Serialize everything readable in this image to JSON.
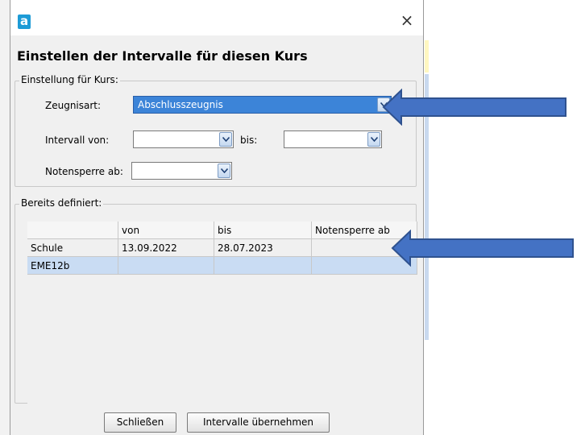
{
  "window": {
    "title": "Einstellen der Intervalle für diesen Kurs",
    "app_logo": "a",
    "close_glyph": "×"
  },
  "settings": {
    "legend": "Einstellung für Kurs:",
    "zeugnisart_label": "Zeugnisart:",
    "zeugnisart_value": "Abschlusszeugnis",
    "intervall_von_label": "Intervall von:",
    "intervall_von_value": "",
    "bis_label": "bis:",
    "bis_value": "",
    "notensperre_label": "Notensperre ab:",
    "notensperre_value": ""
  },
  "defined": {
    "legend": "Bereits definiert:",
    "columns": [
      "",
      "von",
      "bis",
      "Notensperre ab"
    ],
    "rows": [
      [
        "Schule",
        "13.09.2022",
        "28.07.2023",
        ""
      ],
      [
        "EME12b",
        "",
        "",
        ""
      ]
    ]
  },
  "buttons": {
    "close_label": "Schließen",
    "apply_label": "Intervalle übernehmen"
  },
  "colors": {
    "selection": "#3c84d8",
    "row_highlight": "#c9dcf3",
    "annotation_arrow": "#4472c4"
  },
  "icons": [
    "app-logo-icon",
    "close-icon",
    "chevron-down-icon",
    "annotation-arrow"
  ]
}
